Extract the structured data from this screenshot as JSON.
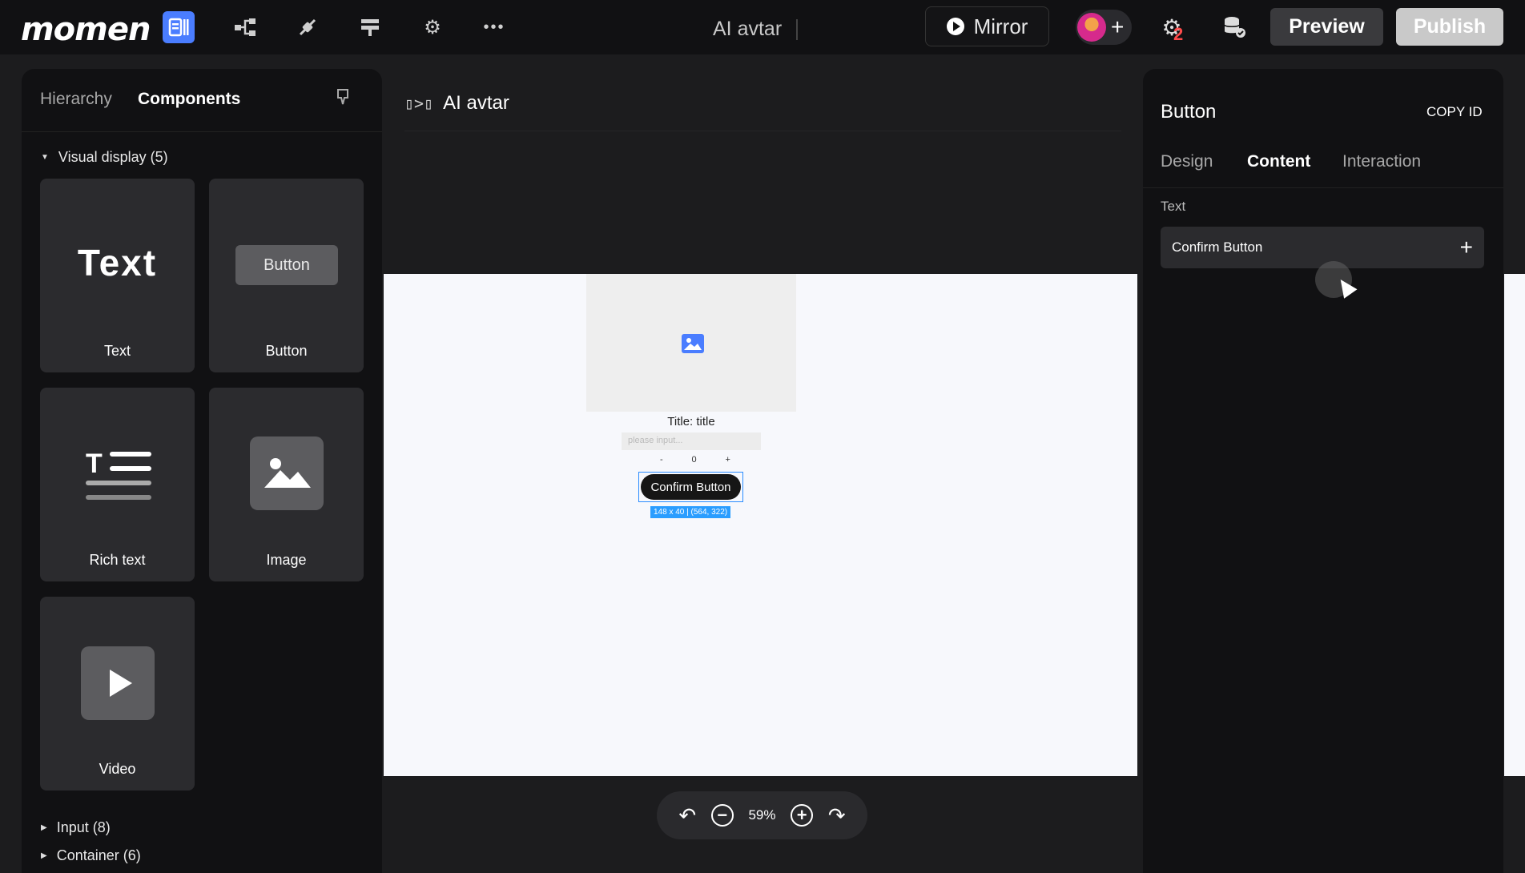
{
  "topbar": {
    "logo": "momen",
    "doc_title": "AI avtar",
    "mirror_label": "Mirror",
    "avatar_plus": "+",
    "issues_count": "2",
    "preview_label": "Preview",
    "publish_label": "Publish",
    "more_glyph": "•••"
  },
  "left_panel": {
    "tabs": [
      "Hierarchy",
      "Components"
    ],
    "active_tab": "Components",
    "sections": {
      "visual_display": "Visual display (5)",
      "input": "Input (8)",
      "container": "Container (6)"
    },
    "cards": [
      {
        "label": "Text",
        "glyph": "Text"
      },
      {
        "label": "Button",
        "glyph": "Button"
      },
      {
        "label": "Rich text",
        "glyph": "T"
      },
      {
        "label": "Image"
      },
      {
        "label": "Video"
      }
    ]
  },
  "canvas": {
    "page_title": "AI avtar",
    "page_icon": "▯>▯",
    "title_text": "Title: title",
    "input_placeholder": "please input...",
    "stepper": {
      "minus": "-",
      "value": "0",
      "plus": "+"
    },
    "button_text": "Confirm Button",
    "selection_tag": "148 x 40 | (564, 322)"
  },
  "zoom": {
    "undo": "↶",
    "minus": "−",
    "value": "59%",
    "plus": "+",
    "redo": "↷"
  },
  "right_panel": {
    "title": "Button",
    "copy_id": "COPY ID",
    "tabs": [
      "Design",
      "Content",
      "Interaction"
    ],
    "active_tab": "Content",
    "field_label": "Text",
    "field_value": "Confirm Button",
    "field_plus": "+"
  },
  "colors": {
    "accent": "#4a7dff",
    "selection": "#2a8cff",
    "warning": "#ff4b4b"
  }
}
